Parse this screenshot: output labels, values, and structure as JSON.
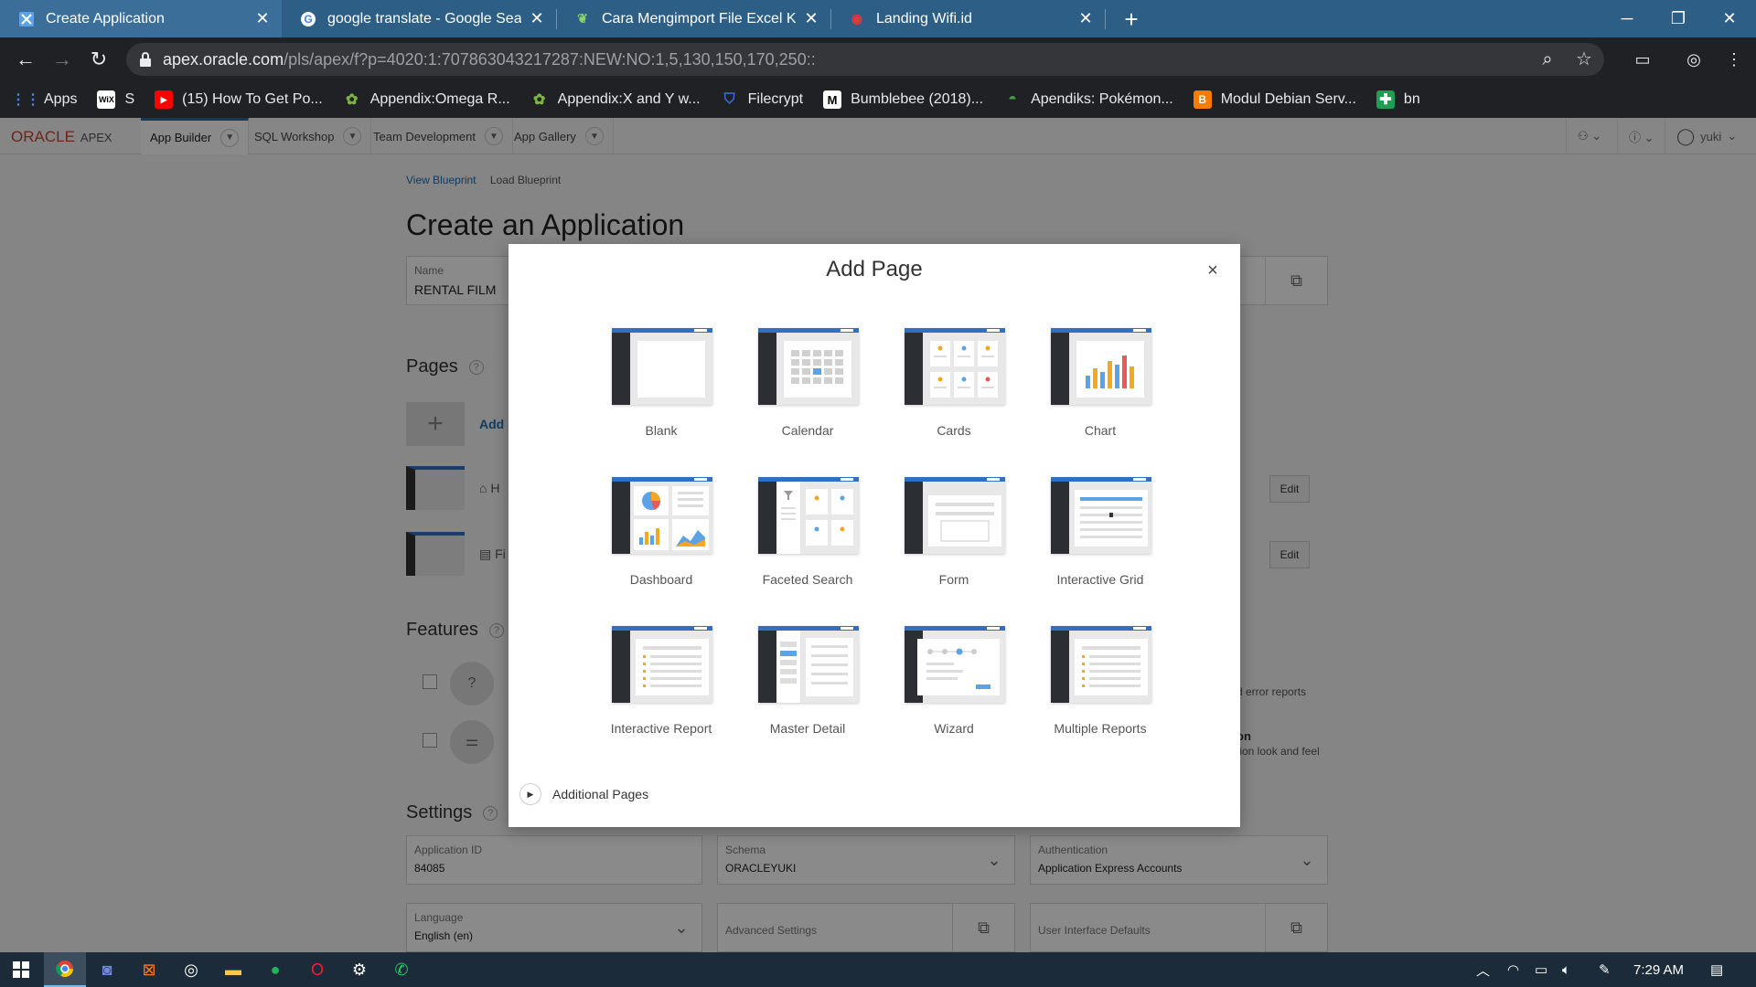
{
  "browser": {
    "tabs": [
      {
        "title": "Create Application",
        "icon": "apex-icon",
        "active": true
      },
      {
        "title": "google translate - Google Search",
        "icon": "google-icon",
        "active": false
      },
      {
        "title": "Cara Mengimport File Excel Ke Si",
        "icon": "leaf-icon",
        "active": false
      },
      {
        "title": "Landing Wifi.id",
        "icon": "wifi-icon",
        "active": false
      }
    ],
    "url_host": "apex.oracle.com",
    "url_path": "/pls/apex/f?p=4020:1:707863043217287:NEW:NO:1,5,130,150,170,250::",
    "bookmarks": [
      {
        "label": "Apps",
        "icon": "apps-grid-icon",
        "color": "#4285f4"
      },
      {
        "label": "S",
        "icon": "wix-icon",
        "color": "#ffffff"
      },
      {
        "label": "(15) How To Get Po...",
        "icon": "youtube-icon",
        "color": "#ff0000"
      },
      {
        "label": "Appendix:Omega R...",
        "icon": "wiki-icon",
        "color": "#7cb342"
      },
      {
        "label": "Appendix:X and Y w...",
        "icon": "wiki-icon",
        "color": "#7cb342"
      },
      {
        "label": "Filecrypt",
        "icon": "shield-icon",
        "color": "#3b6fd9"
      },
      {
        "label": "Bumblebee (2018)...",
        "icon": "m-icon",
        "color": "#ffffff"
      },
      {
        "label": "Apendiks: Pokémon...",
        "icon": "pokeball-icon",
        "color": "#43a047"
      },
      {
        "label": "Modul Debian Serv...",
        "icon": "blogger-icon",
        "color": "#f57c00"
      },
      {
        "label": "bn",
        "icon": "plus-green-icon",
        "color": "#1e9e50"
      }
    ]
  },
  "apex": {
    "logo_text": "ORACLE",
    "logo_sub": "APEX",
    "nav": [
      "App Builder",
      "SQL Workshop",
      "Team Development",
      "App Gallery"
    ],
    "user": "yuki"
  },
  "page": {
    "breadcrumb": [
      "View Blueprint",
      "Load Blueprint"
    ],
    "title": "Create an Application",
    "name_label": "Name",
    "name_value": "RENTAL FILM",
    "pages_heading": "Pages",
    "add_label": "Add",
    "page_rows": [
      {
        "prefix": "H",
        "edit": "Edit"
      },
      {
        "prefix": "Fi",
        "edit": "Edit"
      }
    ],
    "features_heading": "Features",
    "features_right_1": "d error reports",
    "features_right_2a": "on",
    "features_right_2b": "tion look and feel",
    "settings_heading": "Settings",
    "settings": {
      "app_id_label": "Application ID",
      "app_id_value": "84085",
      "schema_label": "Schema",
      "schema_value": "ORACLEYUKI",
      "auth_label": "Authentication",
      "auth_value": "Application Express Accounts",
      "lang_label": "Language",
      "lang_value": "English (en)",
      "adv_label": "Advanced Settings",
      "ui_label": "User Interface Defaults"
    }
  },
  "modal": {
    "title": "Add Page",
    "close": "×",
    "tiles": [
      "Blank",
      "Calendar",
      "Cards",
      "Chart",
      "Dashboard",
      "Faceted Search",
      "Form",
      "Interactive Grid",
      "Interactive Report",
      "Master Detail",
      "Wizard",
      "Multiple Reports"
    ],
    "additional": "Additional Pages"
  },
  "taskbar": {
    "time": "7:29 AM"
  }
}
